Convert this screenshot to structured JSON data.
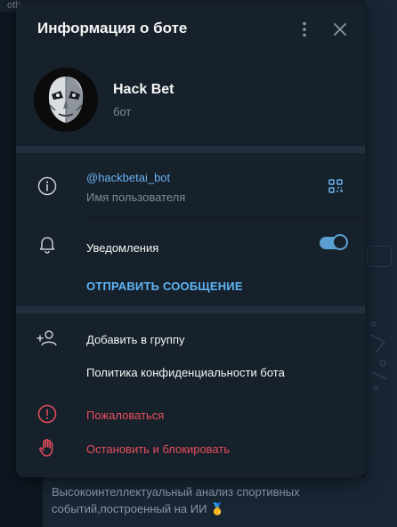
{
  "background": {
    "topbar_text": "oth",
    "last_message": "Высокоинтеллектуальный анализ спортивных событий,построенный на ИИ",
    "medal": "🥇"
  },
  "dialog": {
    "title": "Информация о боте",
    "more_icon": "more-vertical-icon",
    "close_icon": "close-icon"
  },
  "profile": {
    "name": "Hack Bet",
    "subtitle": "бот"
  },
  "info": {
    "username": "@hackbetai_bot",
    "username_caption": "Имя пользователя",
    "notifications_label": "Уведомления",
    "notifications_on": true,
    "send_message": "ОТПРАВИТЬ СООБЩЕНИЕ"
  },
  "actions": {
    "add_to_group": "Добавить в группу",
    "privacy_policy": "Политика конфиденциальности бота",
    "report": "Пожаловаться",
    "block": "Остановить и блокировать"
  },
  "colors": {
    "accent": "#6ab3f3",
    "danger": "#e64d5e",
    "panel": "#17212b",
    "separator": "#232e3c",
    "toggle": "#5ca0d3"
  }
}
